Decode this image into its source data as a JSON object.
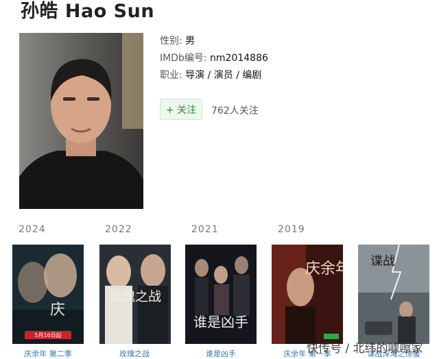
{
  "header": {
    "title": "孙皓 Hao Sun"
  },
  "profile": {
    "gender_label": "性别:",
    "gender": "男",
    "imdb_label": "IMDb编号:",
    "imdb": "nm2014886",
    "job_label": "职业:",
    "job": "导演 / 演员 / 编剧"
  },
  "follow": {
    "button_label": "+ 关注",
    "count": "762人关注"
  },
  "works": [
    {
      "year": "2024",
      "poster_text": "5月16日起",
      "title": "庆余年 第二季"
    },
    {
      "year": "2022",
      "poster_text": "玫瑰之战",
      "title": "玫瑰之战"
    },
    {
      "year": "2021",
      "poster_text": "谁是凶手",
      "title": "谁是凶手"
    },
    {
      "year": "2019",
      "poster_text": "庆余年",
      "title": "庆余年 第一季"
    },
    {
      "year": "",
      "poster_text": "谍战",
      "title": "谍战深海之惊蛰"
    }
  ],
  "watermark": "快传号 / 北纬的噱嚓家",
  "colors": {
    "follow_green": "#2e8b3e",
    "link_blue": "#3377aa"
  }
}
